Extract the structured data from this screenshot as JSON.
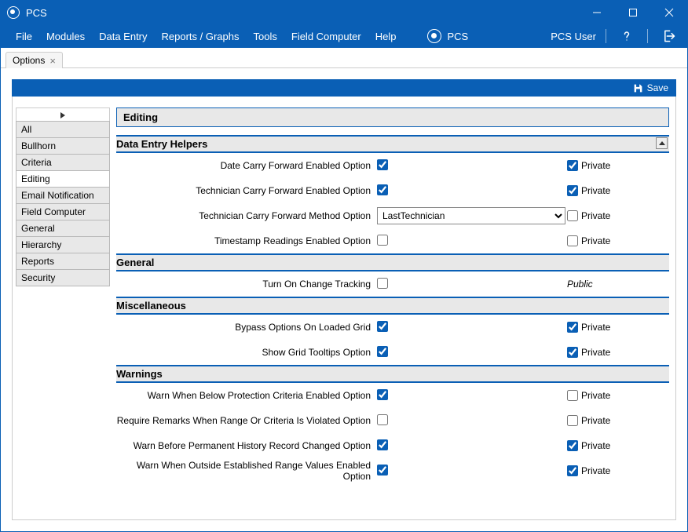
{
  "app": {
    "title": "PCS"
  },
  "menu": {
    "items": [
      "File",
      "Modules",
      "Data Entry",
      "Reports / Graphs",
      "Tools",
      "Field Computer",
      "Help"
    ],
    "brand": "PCS",
    "user": "PCS User"
  },
  "tab": {
    "label": "Options"
  },
  "actions": {
    "save": "Save"
  },
  "sidebar": {
    "items": [
      "All",
      "Bullhorn",
      "Criteria",
      "Editing",
      "Email Notification",
      "Field Computer",
      "General",
      "Hierarchy",
      "Reports",
      "Security"
    ],
    "active": "Editing"
  },
  "page": {
    "title": "Editing",
    "sections": [
      {
        "title": "Data Entry Helpers",
        "collapse_btn": true,
        "rows": [
          {
            "label": "Date Carry Forward Enabled Option",
            "type": "check",
            "checked": true,
            "priv_type": "check",
            "priv_checked": true,
            "priv_label": "Private"
          },
          {
            "label": "Technician Carry Forward Enabled Option",
            "type": "check",
            "checked": true,
            "priv_type": "check",
            "priv_checked": true,
            "priv_label": "Private"
          },
          {
            "label": "Technician Carry Forward Method Option",
            "type": "select",
            "value": "LastTechnician",
            "priv_type": "check",
            "priv_checked": false,
            "priv_label": "Private"
          },
          {
            "label": "Timestamp Readings Enabled Option",
            "type": "check",
            "checked": false,
            "priv_type": "check",
            "priv_checked": false,
            "priv_label": "Private"
          }
        ]
      },
      {
        "title": "General",
        "rows": [
          {
            "label": "Turn On Change Tracking",
            "type": "check",
            "checked": false,
            "priv_type": "public",
            "priv_label": "Public"
          }
        ]
      },
      {
        "title": "Miscellaneous",
        "rows": [
          {
            "label": "Bypass Options On Loaded Grid",
            "type": "check",
            "checked": true,
            "priv_type": "check",
            "priv_checked": true,
            "priv_label": "Private"
          },
          {
            "label": "Show Grid Tooltips Option",
            "type": "check",
            "checked": true,
            "priv_type": "check",
            "priv_checked": true,
            "priv_label": "Private"
          }
        ]
      },
      {
        "title": "Warnings",
        "rows": [
          {
            "label": "Warn When Below Protection Criteria Enabled Option",
            "type": "check",
            "checked": true,
            "priv_type": "check",
            "priv_checked": false,
            "priv_label": "Private"
          },
          {
            "label": "Require Remarks When Range Or Criteria Is Violated Option",
            "type": "check",
            "checked": false,
            "priv_type": "check",
            "priv_checked": false,
            "priv_label": "Private"
          },
          {
            "label": "Warn Before Permanent History Record Changed Option",
            "type": "check",
            "checked": true,
            "priv_type": "check",
            "priv_checked": true,
            "priv_label": "Private"
          },
          {
            "label": "Warn When Outside Established Range Values Enabled Option",
            "type": "check",
            "checked": true,
            "priv_type": "check",
            "priv_checked": true,
            "priv_label": "Private"
          }
        ]
      }
    ]
  }
}
